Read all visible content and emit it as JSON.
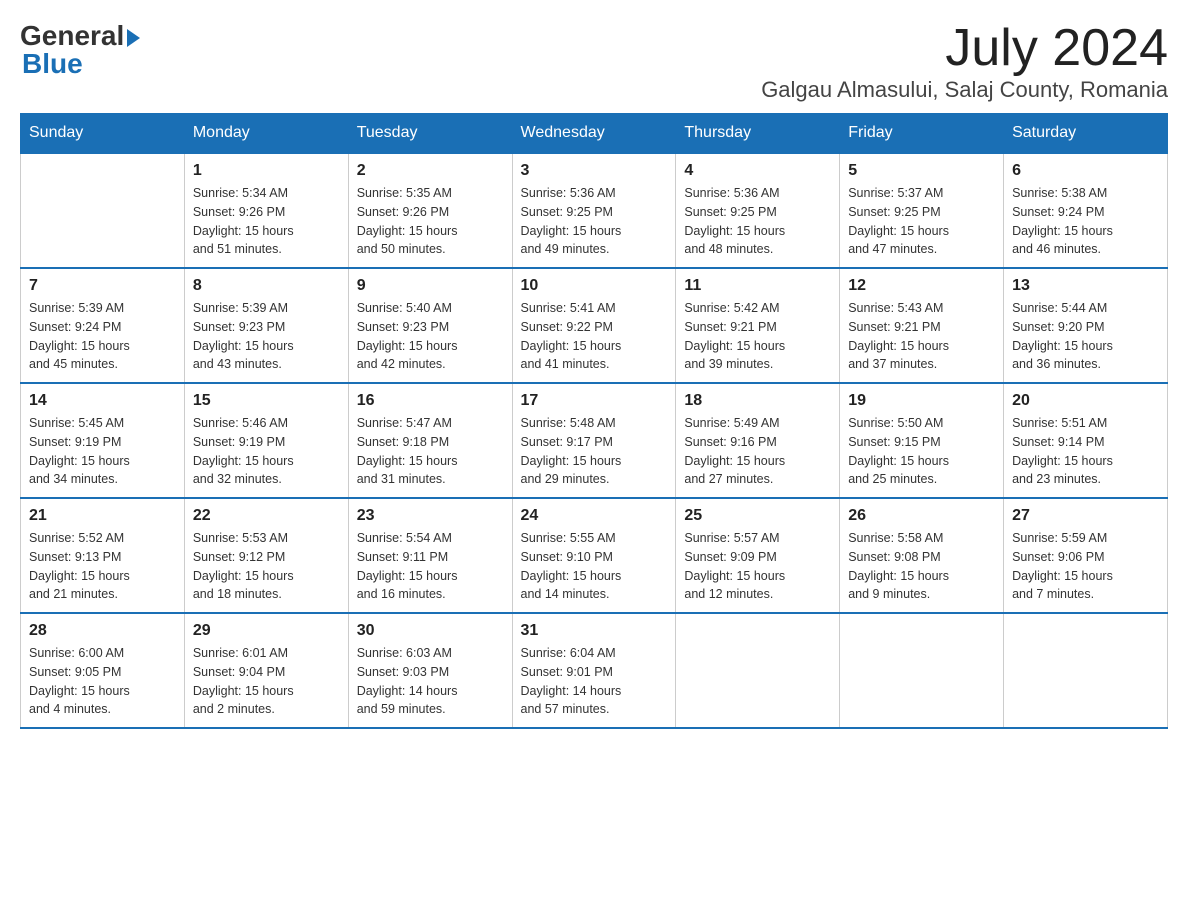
{
  "header": {
    "logo": {
      "general": "General",
      "blue": "Blue",
      "tagline": ""
    },
    "month_year": "July 2024",
    "location": "Galgau Almasului, Salaj County, Romania"
  },
  "days_of_week": [
    "Sunday",
    "Monday",
    "Tuesday",
    "Wednesday",
    "Thursday",
    "Friday",
    "Saturday"
  ],
  "weeks": [
    [
      {
        "day": "",
        "info": ""
      },
      {
        "day": "1",
        "info": "Sunrise: 5:34 AM\nSunset: 9:26 PM\nDaylight: 15 hours\nand 51 minutes."
      },
      {
        "day": "2",
        "info": "Sunrise: 5:35 AM\nSunset: 9:26 PM\nDaylight: 15 hours\nand 50 minutes."
      },
      {
        "day": "3",
        "info": "Sunrise: 5:36 AM\nSunset: 9:25 PM\nDaylight: 15 hours\nand 49 minutes."
      },
      {
        "day": "4",
        "info": "Sunrise: 5:36 AM\nSunset: 9:25 PM\nDaylight: 15 hours\nand 48 minutes."
      },
      {
        "day": "5",
        "info": "Sunrise: 5:37 AM\nSunset: 9:25 PM\nDaylight: 15 hours\nand 47 minutes."
      },
      {
        "day": "6",
        "info": "Sunrise: 5:38 AM\nSunset: 9:24 PM\nDaylight: 15 hours\nand 46 minutes."
      }
    ],
    [
      {
        "day": "7",
        "info": "Sunrise: 5:39 AM\nSunset: 9:24 PM\nDaylight: 15 hours\nand 45 minutes."
      },
      {
        "day": "8",
        "info": "Sunrise: 5:39 AM\nSunset: 9:23 PM\nDaylight: 15 hours\nand 43 minutes."
      },
      {
        "day": "9",
        "info": "Sunrise: 5:40 AM\nSunset: 9:23 PM\nDaylight: 15 hours\nand 42 minutes."
      },
      {
        "day": "10",
        "info": "Sunrise: 5:41 AM\nSunset: 9:22 PM\nDaylight: 15 hours\nand 41 minutes."
      },
      {
        "day": "11",
        "info": "Sunrise: 5:42 AM\nSunset: 9:21 PM\nDaylight: 15 hours\nand 39 minutes."
      },
      {
        "day": "12",
        "info": "Sunrise: 5:43 AM\nSunset: 9:21 PM\nDaylight: 15 hours\nand 37 minutes."
      },
      {
        "day": "13",
        "info": "Sunrise: 5:44 AM\nSunset: 9:20 PM\nDaylight: 15 hours\nand 36 minutes."
      }
    ],
    [
      {
        "day": "14",
        "info": "Sunrise: 5:45 AM\nSunset: 9:19 PM\nDaylight: 15 hours\nand 34 minutes."
      },
      {
        "day": "15",
        "info": "Sunrise: 5:46 AM\nSunset: 9:19 PM\nDaylight: 15 hours\nand 32 minutes."
      },
      {
        "day": "16",
        "info": "Sunrise: 5:47 AM\nSunset: 9:18 PM\nDaylight: 15 hours\nand 31 minutes."
      },
      {
        "day": "17",
        "info": "Sunrise: 5:48 AM\nSunset: 9:17 PM\nDaylight: 15 hours\nand 29 minutes."
      },
      {
        "day": "18",
        "info": "Sunrise: 5:49 AM\nSunset: 9:16 PM\nDaylight: 15 hours\nand 27 minutes."
      },
      {
        "day": "19",
        "info": "Sunrise: 5:50 AM\nSunset: 9:15 PM\nDaylight: 15 hours\nand 25 minutes."
      },
      {
        "day": "20",
        "info": "Sunrise: 5:51 AM\nSunset: 9:14 PM\nDaylight: 15 hours\nand 23 minutes."
      }
    ],
    [
      {
        "day": "21",
        "info": "Sunrise: 5:52 AM\nSunset: 9:13 PM\nDaylight: 15 hours\nand 21 minutes."
      },
      {
        "day": "22",
        "info": "Sunrise: 5:53 AM\nSunset: 9:12 PM\nDaylight: 15 hours\nand 18 minutes."
      },
      {
        "day": "23",
        "info": "Sunrise: 5:54 AM\nSunset: 9:11 PM\nDaylight: 15 hours\nand 16 minutes."
      },
      {
        "day": "24",
        "info": "Sunrise: 5:55 AM\nSunset: 9:10 PM\nDaylight: 15 hours\nand 14 minutes."
      },
      {
        "day": "25",
        "info": "Sunrise: 5:57 AM\nSunset: 9:09 PM\nDaylight: 15 hours\nand 12 minutes."
      },
      {
        "day": "26",
        "info": "Sunrise: 5:58 AM\nSunset: 9:08 PM\nDaylight: 15 hours\nand 9 minutes."
      },
      {
        "day": "27",
        "info": "Sunrise: 5:59 AM\nSunset: 9:06 PM\nDaylight: 15 hours\nand 7 minutes."
      }
    ],
    [
      {
        "day": "28",
        "info": "Sunrise: 6:00 AM\nSunset: 9:05 PM\nDaylight: 15 hours\nand 4 minutes."
      },
      {
        "day": "29",
        "info": "Sunrise: 6:01 AM\nSunset: 9:04 PM\nDaylight: 15 hours\nand 2 minutes."
      },
      {
        "day": "30",
        "info": "Sunrise: 6:03 AM\nSunset: 9:03 PM\nDaylight: 14 hours\nand 59 minutes."
      },
      {
        "day": "31",
        "info": "Sunrise: 6:04 AM\nSunset: 9:01 PM\nDaylight: 14 hours\nand 57 minutes."
      },
      {
        "day": "",
        "info": ""
      },
      {
        "day": "",
        "info": ""
      },
      {
        "day": "",
        "info": ""
      }
    ]
  ],
  "colors": {
    "header_bg": "#1a6fb5",
    "header_text": "#ffffff",
    "border": "#1a6fb5",
    "cell_border": "#cccccc"
  }
}
